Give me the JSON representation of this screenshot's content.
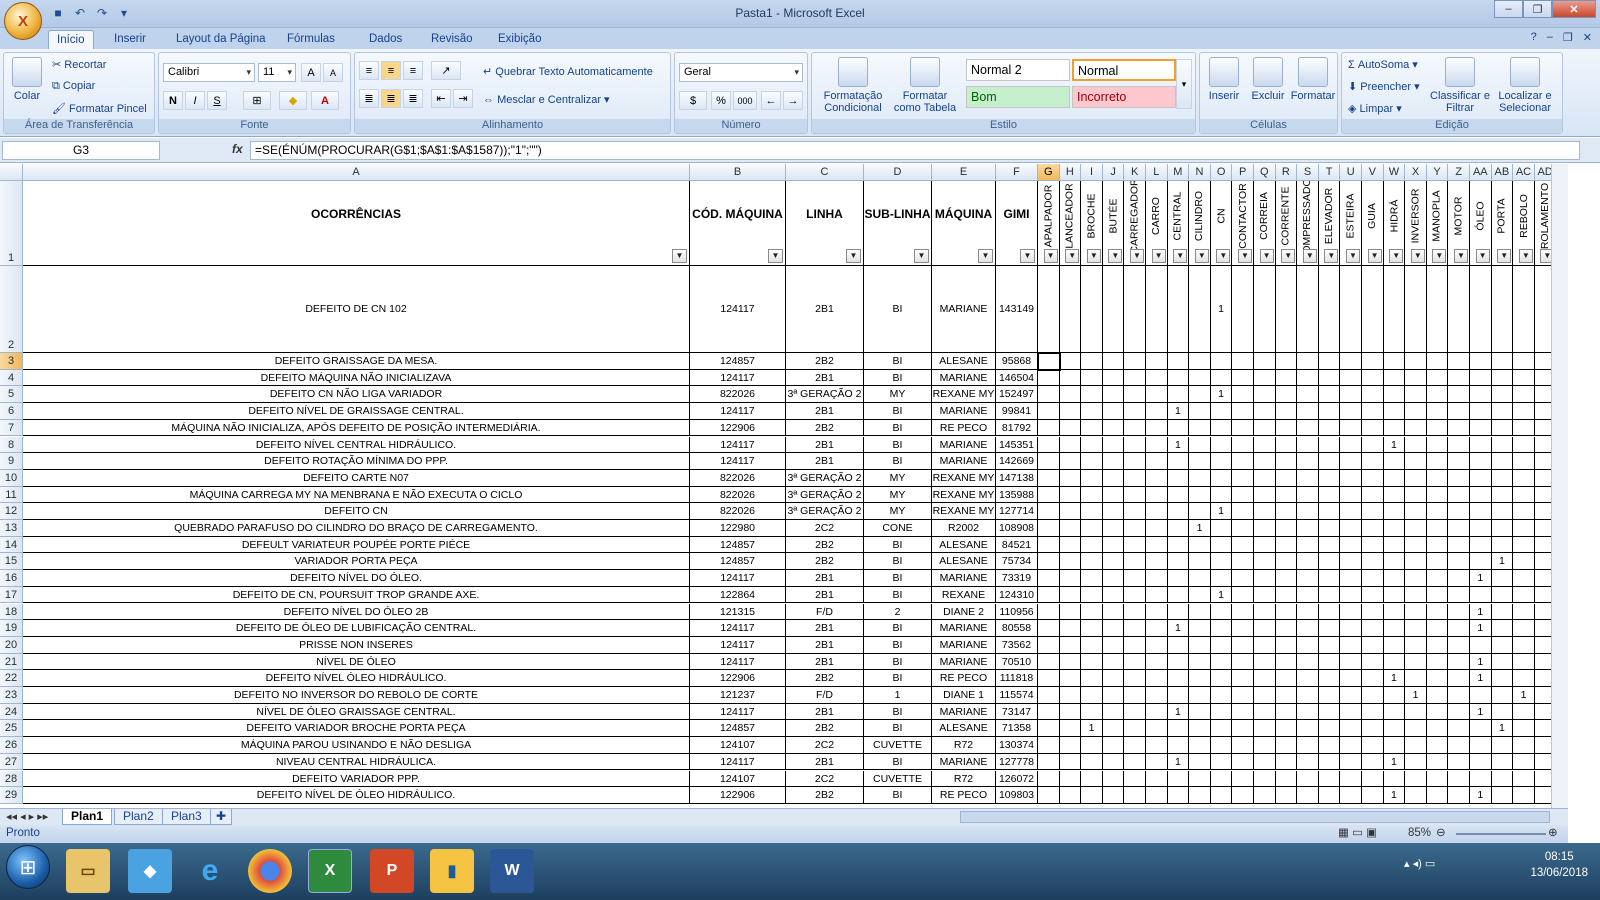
{
  "window": {
    "title": "Pasta1 - Microsoft Excel",
    "app_letter": "X"
  },
  "tabs": [
    "Início",
    "Inserir",
    "Layout da Página",
    "Fórmulas",
    "Dados",
    "Revisão",
    "Exibição"
  ],
  "ribbon": {
    "clipboard": {
      "label": "Área de Transferência",
      "paste": "Colar",
      "cut": "Recortar",
      "copy": "Copiar",
      "painter": "Formatar Pincel"
    },
    "font": {
      "label": "Fonte",
      "name": "Calibri",
      "size": "11"
    },
    "alignment": {
      "label": "Alinhamento",
      "wrap": "Quebrar Texto Automaticamente",
      "merge": "Mesclar e Centralizar"
    },
    "number": {
      "label": "Número",
      "format": "Geral"
    },
    "styles": {
      "label": "Estilo",
      "conditional": "Formatação Condicional",
      "as_table": "Formatar como Tabela",
      "normal2": "Normal 2",
      "normal": "Normal",
      "good": "Bom",
      "bad": "Incorreto"
    },
    "cells": {
      "label": "Células",
      "insert": "Inserir",
      "delete": "Excluir",
      "format": "Formatar"
    },
    "editing": {
      "label": "Edição",
      "autosum": "AutoSoma",
      "fill": "Preencher",
      "clear": "Limpar",
      "sort": "Classificar e Filtrar",
      "find": "Localizar e Selecionar"
    }
  },
  "formula_bar": {
    "name_box": "G3",
    "fx": "fx",
    "formula": "=SE(ÉNÚM(PROCURAR(G$1;$A$1:$A$1587));\"1\";\"\")"
  },
  "columns": [
    "A",
    "B",
    "C",
    "D",
    "E",
    "F",
    "G",
    "H",
    "I",
    "J",
    "K",
    "L",
    "M",
    "N",
    "O",
    "P",
    "Q",
    "R",
    "S",
    "T",
    "U",
    "V",
    "W",
    "X",
    "Y",
    "Z",
    "AA",
    "AB",
    "AC",
    "AD"
  ],
  "header_row": {
    "A": "OCORRÊNCIAS",
    "B": "CÓD. MÁQUINA",
    "C": "LINHA",
    "D": "SUB-LINHA",
    "E": "MÁQUINA",
    "F": "GIMI",
    "vertical": [
      "APALPADOR",
      "LANCEADOR",
      "BROCHE",
      "BUTÉE",
      "CARREGADOR",
      "CARRO",
      "CENTRAL",
      "CILINDRO",
      "CN",
      "CONTACTOR",
      "CORREIA",
      "CORRENTE",
      "COMPRESSADOR",
      "ELEVADOR",
      "ESTEIRA",
      "GUIA",
      "HIDRÁ",
      "INVERSOR",
      "MANOPLA",
      "MOTOR",
      "ÓLEO",
      "PORTA",
      "REBOLO",
      "ROLAMENTO"
    ]
  },
  "rows": [
    {
      "n": "2",
      "a": "DEFEITO DE CN 102",
      "b": "124117",
      "c": "2B1",
      "d": "BI",
      "e": "MARIANE",
      "f": "143149",
      "marks": [
        8
      ]
    },
    {
      "n": "3",
      "a": "DEFEITO GRAISSAGE DA MESA.",
      "b": "124857",
      "c": "2B2",
      "d": "BI",
      "e": "ALESANE",
      "f": "95868",
      "marks": []
    },
    {
      "n": "4",
      "a": "DEFEITO MÁQUINA NÃO INICIALIZAVA",
      "b": "124117",
      "c": "2B1",
      "d": "BI",
      "e": "MARIANE",
      "f": "146504",
      "marks": []
    },
    {
      "n": "5",
      "a": "DEFEITO CN NÃO LIGA VARIADOR",
      "b": "822026",
      "c": "3ª GERAÇÃO 2",
      "d": "MY",
      "e": "REXANE MY",
      "f": "152497",
      "marks": [
        8
      ]
    },
    {
      "n": "6",
      "a": "DEFEITO NÍVEL DE GRAISSAGE CENTRAL.",
      "b": "124117",
      "c": "2B1",
      "d": "BI",
      "e": "MARIANE",
      "f": "99841",
      "marks": [
        6
      ]
    },
    {
      "n": "7",
      "a": "MÁQUINA NÃO INICIALIZA, APÓS DEFEITO DE POSIÇÃO INTERMEDIÁRIA.",
      "b": "122906",
      "c": "2B2",
      "d": "BI",
      "e": "RE PECO",
      "f": "81792",
      "marks": []
    },
    {
      "n": "8",
      "a": "DEFEITO NÍVEL CENTRAL HIDRÁULICO.",
      "b": "124117",
      "c": "2B1",
      "d": "BI",
      "e": "MARIANE",
      "f": "145351",
      "marks": [
        6,
        16
      ]
    },
    {
      "n": "9",
      "a": "DEFEITO ROTAÇÃO MÍNIMA DO PPP.",
      "b": "124117",
      "c": "2B1",
      "d": "BI",
      "e": "MARIANE",
      "f": "142669",
      "marks": []
    },
    {
      "n": "10",
      "a": "DEFEITO CARTE N07",
      "b": "822026",
      "c": "3ª GERAÇÃO 2",
      "d": "MY",
      "e": "REXANE MY",
      "f": "147138",
      "marks": []
    },
    {
      "n": "11",
      "a": "MÁQUINA CARREGA MY NA MENBRANA E NÃO EXECUTA O CICLO",
      "b": "822026",
      "c": "3ª GERAÇÃO 2",
      "d": "MY",
      "e": "REXANE MY",
      "f": "135988",
      "marks": []
    },
    {
      "n": "12",
      "a": "DEFEITO CN",
      "b": "822026",
      "c": "3ª GERAÇÃO 2",
      "d": "MY",
      "e": "REXANE MY",
      "f": "127714",
      "marks": [
        8
      ]
    },
    {
      "n": "13",
      "a": "QUEBRADO PARAFUSO DO CILINDRO DO BRAÇO DE CARREGAMENTO.",
      "b": "122980",
      "c": "2C2",
      "d": "CONE",
      "e": "R2002",
      "f": "108908",
      "marks": [
        7
      ]
    },
    {
      "n": "14",
      "a": "DEFEULT VARIATEUR POUPÉE PORTE PIÉCE",
      "b": "124857",
      "c": "2B2",
      "d": "BI",
      "e": "ALESANE",
      "f": "84521",
      "marks": []
    },
    {
      "n": "15",
      "a": "VARIADOR PORTA PEÇA",
      "b": "124857",
      "c": "2B2",
      "d": "BI",
      "e": "ALESANE",
      "f": "75734",
      "marks": [
        21
      ]
    },
    {
      "n": "16",
      "a": "DEFEITO NÍVEL DO ÓLEO.",
      "b": "124117",
      "c": "2B1",
      "d": "BI",
      "e": "MARIANE",
      "f": "73319",
      "marks": [
        20
      ]
    },
    {
      "n": "17",
      "a": "DEFEITO DE CN, POURSUIT TROP GRANDE AXE.",
      "b": "122864",
      "c": "2B1",
      "d": "BI",
      "e": "REXANE",
      "f": "124310",
      "marks": [
        8
      ]
    },
    {
      "n": "18",
      "a": "DEFEITO NÍVEL DO ÓLEO 2B",
      "b": "121315",
      "c": "F/D",
      "d": "2",
      "e": "DIANE 2",
      "f": "110956",
      "marks": [
        20
      ]
    },
    {
      "n": "19",
      "a": "DEFEITO DE ÓLEO DE LUBIFICAÇÃO CENTRAL.",
      "b": "124117",
      "c": "2B1",
      "d": "BI",
      "e": "MARIANE",
      "f": "80558",
      "marks": [
        6,
        20
      ]
    },
    {
      "n": "20",
      "a": "PRISSE NON INSERES",
      "b": "124117",
      "c": "2B1",
      "d": "BI",
      "e": "MARIANE",
      "f": "73562",
      "marks": []
    },
    {
      "n": "21",
      "a": "NÍVEL DE ÓLEO",
      "b": "124117",
      "c": "2B1",
      "d": "BI",
      "e": "MARIANE",
      "f": "70510",
      "marks": [
        20
      ]
    },
    {
      "n": "22",
      "a": "DEFEITO NÍVEL ÓLEO HIDRÁULICO.",
      "b": "122906",
      "c": "2B2",
      "d": "BI",
      "e": "RE PECO",
      "f": "111818",
      "marks": [
        16,
        20
      ]
    },
    {
      "n": "23",
      "a": "DEFEITO NO INVERSOR DO REBOLO DE CORTE",
      "b": "121237",
      "c": "F/D",
      "d": "1",
      "e": "DIANE 1",
      "f": "115574",
      "marks": [
        17,
        22
      ]
    },
    {
      "n": "24",
      "a": "NÍVEL DE ÓLEO GRAISSAGE CENTRAL.",
      "b": "124117",
      "c": "2B1",
      "d": "BI",
      "e": "MARIANE",
      "f": "73147",
      "marks": [
        6,
        20
      ]
    },
    {
      "n": "25",
      "a": "DEFEITO VARIADOR BROCHE PORTA PEÇA",
      "b": "124857",
      "c": "2B2",
      "d": "BI",
      "e": "ALESANE",
      "f": "71358",
      "marks": [
        2,
        21
      ]
    },
    {
      "n": "26",
      "a": "MÁQUINA PAROU USINANDO E NÃO DESLIGA",
      "b": "124107",
      "c": "2C2",
      "d": "CUVETTE",
      "e": "R72",
      "f": "130374",
      "marks": []
    },
    {
      "n": "27",
      "a": "NIVEAU CENTRAL HIDRÁULICA.",
      "b": "124117",
      "c": "2B1",
      "d": "BI",
      "e": "MARIANE",
      "f": "127778",
      "marks": [
        6,
        16
      ]
    },
    {
      "n": "28",
      "a": "DEFEITO VARIADOR PPP.",
      "b": "124107",
      "c": "2C2",
      "d": "CUVETTE",
      "e": "R72",
      "f": "126072",
      "marks": []
    },
    {
      "n": "29",
      "a": "DEFEITO  NÍVEL DE ÓLEO HIDRÁULICO.",
      "b": "122906",
      "c": "2B2",
      "d": "BI",
      "e": "RE PECO",
      "f": "109803",
      "marks": [
        16,
        20
      ]
    }
  ],
  "mark_value": "1",
  "sheets": [
    "Plan1",
    "Plan2",
    "Plan3"
  ],
  "status": {
    "ready": "Pronto",
    "zoom": "85%"
  },
  "clock": {
    "time": "08:15",
    "date": "13/06/2018"
  }
}
